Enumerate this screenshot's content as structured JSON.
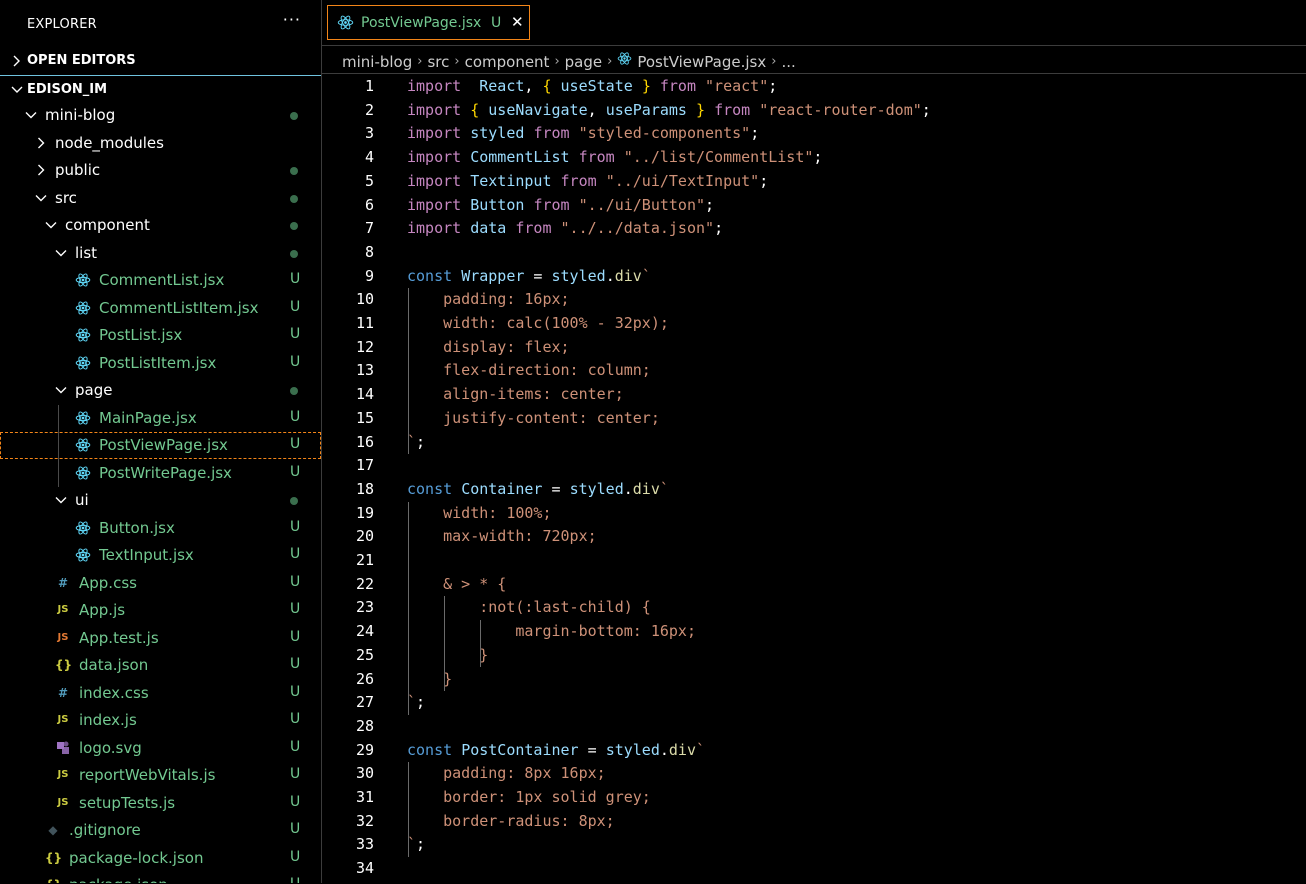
{
  "explorer": {
    "title": "EXPLORER",
    "more": "···",
    "open_editors": "OPEN EDITORS",
    "root": "EDISON_IM",
    "tree": [
      {
        "name": "mini-blog",
        "kind": "folder-open",
        "indent": 0,
        "status": "dot"
      },
      {
        "name": "node_modules",
        "kind": "folder-closed",
        "indent": 1,
        "status": ""
      },
      {
        "name": "public",
        "kind": "folder-closed",
        "indent": 1,
        "status": "dot"
      },
      {
        "name": "src",
        "kind": "folder-open",
        "indent": 1,
        "status": "dot"
      },
      {
        "name": "component",
        "kind": "folder-open",
        "indent": 2,
        "status": "dot"
      },
      {
        "name": "list",
        "kind": "folder-open",
        "indent": 3,
        "status": "dot"
      },
      {
        "name": "CommentList.jsx",
        "kind": "react",
        "indent": 4,
        "status": "U"
      },
      {
        "name": "CommentListItem.jsx",
        "kind": "react",
        "indent": 4,
        "status": "U"
      },
      {
        "name": "PostList.jsx",
        "kind": "react",
        "indent": 4,
        "status": "U"
      },
      {
        "name": "PostListItem.jsx",
        "kind": "react",
        "indent": 4,
        "status": "U"
      },
      {
        "name": "page",
        "kind": "folder-open",
        "indent": 3,
        "status": "dot"
      },
      {
        "name": "MainPage.jsx",
        "kind": "react",
        "indent": 4,
        "status": "U"
      },
      {
        "name": "PostViewPage.jsx",
        "kind": "react",
        "indent": 4,
        "status": "U",
        "selected": true
      },
      {
        "name": "PostWritePage.jsx",
        "kind": "react",
        "indent": 4,
        "status": "U"
      },
      {
        "name": "ui",
        "kind": "folder-open",
        "indent": 3,
        "status": "dot"
      },
      {
        "name": "Button.jsx",
        "kind": "react",
        "indent": 4,
        "status": "U"
      },
      {
        "name": "TextInput.jsx",
        "kind": "react",
        "indent": 4,
        "status": "U"
      },
      {
        "name": "App.css",
        "kind": "css",
        "indent": 2,
        "status": "U"
      },
      {
        "name": "App.js",
        "kind": "js",
        "indent": 2,
        "status": "U"
      },
      {
        "name": "App.test.js",
        "kind": "test",
        "indent": 2,
        "status": "U"
      },
      {
        "name": "data.json",
        "kind": "json",
        "indent": 2,
        "status": "U"
      },
      {
        "name": "index.css",
        "kind": "css",
        "indent": 2,
        "status": "U"
      },
      {
        "name": "index.js",
        "kind": "js",
        "indent": 2,
        "status": "U"
      },
      {
        "name": "logo.svg",
        "kind": "svg",
        "indent": 2,
        "status": "U"
      },
      {
        "name": "reportWebVitals.js",
        "kind": "js",
        "indent": 2,
        "status": "U"
      },
      {
        "name": "setupTests.js",
        "kind": "js",
        "indent": 2,
        "status": "U"
      },
      {
        "name": ".gitignore",
        "kind": "git",
        "indent": 1,
        "status": "U"
      },
      {
        "name": "package-lock.json",
        "kind": "json",
        "indent": 1,
        "status": "U"
      },
      {
        "name": "package.json",
        "kind": "json",
        "indent": 1,
        "status": "U"
      }
    ]
  },
  "icons": {
    "css": "#",
    "js": "JS",
    "test": "JS",
    "json": "{}",
    "git": "◆"
  },
  "colors": {
    "accent_border": "#f38518",
    "untracked": "#73c991",
    "react": "#61dafb",
    "css_icon": "#519aba",
    "js_icon": "#cbcb41",
    "test_icon": "#e37933",
    "svg_icon": "#a074c4",
    "git_icon": "#41535b"
  },
  "tab": {
    "name": "PostViewPage.jsx",
    "badge": "U",
    "close": "✕"
  },
  "breadcrumb": [
    "mini-blog",
    "src",
    "component",
    "page",
    "PostViewPage.jsx",
    "..."
  ],
  "code": [
    {
      "n": "1",
      "t": [
        [
          "imp",
          "import"
        ],
        [
          "",
          "  "
        ],
        [
          "var",
          "React"
        ],
        [
          "",
          ", "
        ],
        [
          "yb",
          "{"
        ],
        [
          "",
          " "
        ],
        [
          "var",
          "useState"
        ],
        [
          "",
          " "
        ],
        [
          "yb",
          "}"
        ],
        [
          "",
          " "
        ],
        [
          "imp",
          "from"
        ],
        [
          "",
          " "
        ],
        [
          "str",
          "\"react\""
        ],
        [
          "",
          ";"
        ]
      ]
    },
    {
      "n": "2",
      "t": [
        [
          "imp",
          "import"
        ],
        [
          "",
          " "
        ],
        [
          "yb",
          "{"
        ],
        [
          "",
          " "
        ],
        [
          "var",
          "useNavigate"
        ],
        [
          "",
          ", "
        ],
        [
          "var",
          "useParams"
        ],
        [
          "",
          " "
        ],
        [
          "yb",
          "}"
        ],
        [
          "",
          " "
        ],
        [
          "imp",
          "from"
        ],
        [
          "",
          " "
        ],
        [
          "str",
          "\"react-router-dom\""
        ],
        [
          "",
          ";"
        ]
      ]
    },
    {
      "n": "3",
      "t": [
        [
          "imp",
          "import"
        ],
        [
          "",
          " "
        ],
        [
          "var",
          "styled"
        ],
        [
          "",
          " "
        ],
        [
          "imp",
          "from"
        ],
        [
          "",
          " "
        ],
        [
          "str",
          "\"styled-components\""
        ],
        [
          "",
          ";"
        ]
      ]
    },
    {
      "n": "4",
      "t": [
        [
          "imp",
          "import"
        ],
        [
          "",
          " "
        ],
        [
          "var",
          "CommentList"
        ],
        [
          "",
          " "
        ],
        [
          "imp",
          "from"
        ],
        [
          "",
          " "
        ],
        [
          "str",
          "\"../list/CommentList\""
        ],
        [
          "",
          ";"
        ]
      ]
    },
    {
      "n": "5",
      "t": [
        [
          "imp",
          "import"
        ],
        [
          "",
          " "
        ],
        [
          "var",
          "Textinput"
        ],
        [
          "",
          " "
        ],
        [
          "imp",
          "from"
        ],
        [
          "",
          " "
        ],
        [
          "str",
          "\"../ui/TextInput\""
        ],
        [
          "",
          ";"
        ]
      ]
    },
    {
      "n": "6",
      "t": [
        [
          "imp",
          "import"
        ],
        [
          "",
          " "
        ],
        [
          "var",
          "Button"
        ],
        [
          "",
          " "
        ],
        [
          "imp",
          "from"
        ],
        [
          "",
          " "
        ],
        [
          "str",
          "\"../ui/Button\""
        ],
        [
          "",
          ";"
        ]
      ]
    },
    {
      "n": "7",
      "t": [
        [
          "imp",
          "import"
        ],
        [
          "",
          " "
        ],
        [
          "var",
          "data"
        ],
        [
          "",
          " "
        ],
        [
          "imp",
          "from"
        ],
        [
          "",
          " "
        ],
        [
          "str",
          "\"../../data.json\""
        ],
        [
          "",
          ";"
        ]
      ]
    },
    {
      "n": "8",
      "t": []
    },
    {
      "n": "9",
      "t": [
        [
          "kw",
          "const"
        ],
        [
          "",
          " "
        ],
        [
          "var",
          "Wrapper"
        ],
        [
          "",
          " = "
        ],
        [
          "var",
          "styled"
        ],
        [
          "",
          "."
        ],
        [
          "fn",
          "div"
        ],
        [
          "css",
          "`"
        ]
      ]
    },
    {
      "n": "10",
      "t": [
        [
          "css",
          "    padding: 16px;"
        ]
      ]
    },
    {
      "n": "11",
      "t": [
        [
          "css",
          "    width: calc(100% - 32px);"
        ]
      ]
    },
    {
      "n": "12",
      "t": [
        [
          "css",
          "    display: flex;"
        ]
      ]
    },
    {
      "n": "13",
      "t": [
        [
          "css",
          "    flex-direction: column;"
        ]
      ]
    },
    {
      "n": "14",
      "t": [
        [
          "css",
          "    align-items: center;"
        ]
      ]
    },
    {
      "n": "15",
      "t": [
        [
          "css",
          "    justify-content: center;"
        ]
      ]
    },
    {
      "n": "16",
      "t": [
        [
          "css",
          "`"
        ],
        [
          "",
          ";"
        ]
      ]
    },
    {
      "n": "17",
      "t": []
    },
    {
      "n": "18",
      "t": [
        [
          "kw",
          "const"
        ],
        [
          "",
          " "
        ],
        [
          "var",
          "Container"
        ],
        [
          "",
          " = "
        ],
        [
          "var",
          "styled"
        ],
        [
          "",
          "."
        ],
        [
          "fn",
          "div"
        ],
        [
          "css",
          "`"
        ]
      ]
    },
    {
      "n": "19",
      "t": [
        [
          "css",
          "    width: 100%;"
        ]
      ]
    },
    {
      "n": "20",
      "t": [
        [
          "css",
          "    max-width: 720px;"
        ]
      ]
    },
    {
      "n": "21",
      "t": []
    },
    {
      "n": "22",
      "t": [
        [
          "css",
          "    & > * {"
        ]
      ]
    },
    {
      "n": "23",
      "t": [
        [
          "css",
          "        :not(:last-child) {"
        ]
      ]
    },
    {
      "n": "24",
      "t": [
        [
          "css",
          "            margin-bottom: 16px;"
        ]
      ]
    },
    {
      "n": "25",
      "t": [
        [
          "css",
          "        }"
        ]
      ]
    },
    {
      "n": "26",
      "t": [
        [
          "css",
          "    }"
        ]
      ]
    },
    {
      "n": "27",
      "t": [
        [
          "css",
          "`"
        ],
        [
          "",
          ";"
        ]
      ]
    },
    {
      "n": "28",
      "t": []
    },
    {
      "n": "29",
      "t": [
        [
          "kw",
          "const"
        ],
        [
          "",
          " "
        ],
        [
          "var",
          "PostContainer"
        ],
        [
          "",
          " = "
        ],
        [
          "var",
          "styled"
        ],
        [
          "",
          "."
        ],
        [
          "fn",
          "div"
        ],
        [
          "css",
          "`"
        ]
      ]
    },
    {
      "n": "30",
      "t": [
        [
          "css",
          "    padding: 8px 16px;"
        ]
      ]
    },
    {
      "n": "31",
      "t": [
        [
          "css",
          "    border: 1px solid grey;"
        ]
      ]
    },
    {
      "n": "32",
      "t": [
        [
          "css",
          "    border-radius: 8px;"
        ]
      ]
    },
    {
      "n": "33",
      "t": [
        [
          "css",
          "`"
        ],
        [
          "",
          ";"
        ]
      ]
    },
    {
      "n": "34",
      "t": []
    }
  ]
}
